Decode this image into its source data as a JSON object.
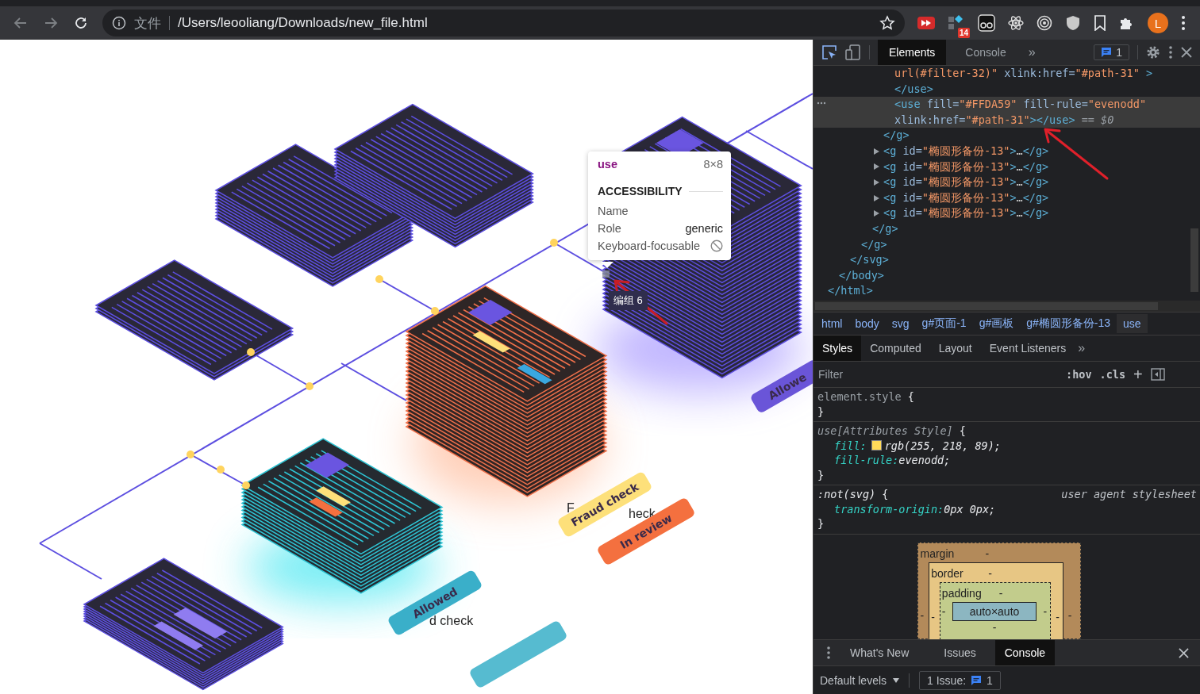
{
  "browser": {
    "site_label": "文件",
    "url": "/Users/leooliang/Downloads/new_file.html",
    "extension_badge": "14",
    "avatar_initial": "L"
  },
  "canvas": {
    "tooltip": {
      "tag": "use",
      "size": "8×8",
      "section": "ACCESSIBILITY",
      "rows": [
        {
          "label": "Name",
          "kind": "empty"
        },
        {
          "label": "Role",
          "kind": "text",
          "value": "generic"
        },
        {
          "label": "Keyboard-focusable",
          "kind": "not-focusable"
        }
      ]
    },
    "group_label": "编组 6",
    "captions": [
      "d check",
      "F",
      "heck"
    ],
    "tags": [
      {
        "text": "Allowed",
        "color": "#3aafc9"
      },
      {
        "text": "Allowe",
        "color": "#6a55d8"
      },
      {
        "text": "Fraud check",
        "color": "#fde07a"
      },
      {
        "text": "In review",
        "color": "#f4703f"
      }
    ]
  },
  "devtools": {
    "tabs": [
      {
        "label": "Elements",
        "selected": true
      },
      {
        "label": "Console",
        "selected": false
      }
    ],
    "more": "»",
    "issues_count": "1",
    "dom": [
      {
        "expanded": true,
        "close": [
          {
            "kind": "tag",
            "t": "</html>"
          }
        ],
        "children": [
          {
            "expanded": true,
            "close": [
              {
                "kind": "tag",
                "t": "</body>"
              }
            ],
            "children": [
              {
                "expanded": true,
                "close": [
                  {
                    "kind": "tag",
                    "t": "</svg>"
                  }
                ],
                "children": [
                  {
                    "expanded": true,
                    "close": [
                      {
                        "kind": "tag",
                        "t": "</g>"
                      }
                    ],
                    "children": [
                      {
                        "expanded": true,
                        "close": [
                          {
                            "kind": "tag",
                            "t": "</g>"
                          }
                        ],
                        "children": [
                          {
                            "expanded": true,
                            "close": [
                              {
                                "kind": "tag",
                                "t": "</g>"
                              }
                            ],
                            "children": [
                              {
                                "selected": false,
                                "lines": [
                                  [
                                    {
                                      "kind": "value",
                                      "t": "url(#filter-32)\""
                                    },
                                    {
                                      "kind": "attr",
                                      "t": "  xlink:href="
                                    },
                                    {
                                      "kind": "value",
                                      "t": "\"#path-31\""
                                    },
                                    {
                                      "kind": "tag",
                                      "t": " >"
                                    }
                                  ],
                                  [
                                    {
                                      "kind": "tag",
                                      "t": "</use>"
                                    }
                                  ]
                                ]
                              },
                              {
                                "selected": true,
                                "lines": [
                                  [
                                    {
                                      "kind": "tag",
                                      "t": "<use"
                                    },
                                    {
                                      "kind": "attr",
                                      "t": " fill="
                                    },
                                    {
                                      "kind": "value",
                                      "t": "\"#FFDA59\""
                                    },
                                    {
                                      "kind": "attr",
                                      "t": " fill-rule="
                                    },
                                    {
                                      "kind": "value",
                                      "t": "\"evenodd\""
                                    }
                                  ],
                                  [
                                    {
                                      "kind": "attr",
                                      "t": "xlink:href="
                                    },
                                    {
                                      "kind": "value",
                                      "t": "\"#path-31\""
                                    },
                                    {
                                      "kind": "tag",
                                      "t": "></use>"
                                    },
                                    {
                                      "kind": "comment",
                                      "t": " == $0"
                                    }
                                  ]
                                ]
                              }
                            ]
                          },
                          {
                            "expanded": false,
                            "tokens": [
                              {
                                "kind": "tag",
                                "t": "<g"
                              },
                              {
                                "kind": "attr",
                                "t": " id="
                              },
                              {
                                "kind": "value",
                                "t": "\"椭圆形备份-13\""
                              },
                              {
                                "kind": "tag",
                                "t": ">"
                              },
                              {
                                "kind": "text",
                                "t": "…"
                              },
                              {
                                "kind": "tag",
                                "t": "</g>"
                              }
                            ]
                          },
                          {
                            "expanded": false,
                            "tokens": [
                              {
                                "kind": "tag",
                                "t": "<g"
                              },
                              {
                                "kind": "attr",
                                "t": " id="
                              },
                              {
                                "kind": "value",
                                "t": "\"椭圆形备份-13\""
                              },
                              {
                                "kind": "tag",
                                "t": ">"
                              },
                              {
                                "kind": "text",
                                "t": "…"
                              },
                              {
                                "kind": "tag",
                                "t": "</g>"
                              }
                            ]
                          },
                          {
                            "expanded": false,
                            "tokens": [
                              {
                                "kind": "tag",
                                "t": "<g"
                              },
                              {
                                "kind": "attr",
                                "t": " id="
                              },
                              {
                                "kind": "value",
                                "t": "\"椭圆形备份-13\""
                              },
                              {
                                "kind": "tag",
                                "t": ">"
                              },
                              {
                                "kind": "text",
                                "t": "…"
                              },
                              {
                                "kind": "tag",
                                "t": "</g>"
                              }
                            ]
                          },
                          {
                            "expanded": false,
                            "tokens": [
                              {
                                "kind": "tag",
                                "t": "<g"
                              },
                              {
                                "kind": "attr",
                                "t": " id="
                              },
                              {
                                "kind": "value",
                                "t": "\"椭圆形备份-13\""
                              },
                              {
                                "kind": "tag",
                                "t": ">"
                              },
                              {
                                "kind": "text",
                                "t": "…"
                              },
                              {
                                "kind": "tag",
                                "t": "</g>"
                              }
                            ]
                          },
                          {
                            "expanded": false,
                            "tokens": [
                              {
                                "kind": "tag",
                                "t": "<g"
                              },
                              {
                                "kind": "attr",
                                "t": " id="
                              },
                              {
                                "kind": "value",
                                "t": "\"椭圆形备份-13\""
                              },
                              {
                                "kind": "tag",
                                "t": ">"
                              },
                              {
                                "kind": "text",
                                "t": "…"
                              },
                              {
                                "kind": "tag",
                                "t": "</g>"
                              }
                            ]
                          }
                        ]
                      }
                    ]
                  }
                ]
              }
            ]
          }
        ]
      }
    ],
    "breadcrumbs": [
      {
        "label": "html",
        "selected": false
      },
      {
        "label": "body",
        "selected": false
      },
      {
        "label": "svg",
        "selected": false
      },
      {
        "label": "g#页面-1",
        "selected": false
      },
      {
        "label": "g#画板",
        "selected": false
      },
      {
        "label": "g#椭圆形备份-13",
        "selected": false
      },
      {
        "label": "use",
        "selected": true
      }
    ],
    "pane_tabs": [
      {
        "label": "Styles",
        "selected": true
      },
      {
        "label": "Computed",
        "selected": false
      },
      {
        "label": "Layout",
        "selected": false
      },
      {
        "label": "Event Listeners",
        "selected": false
      }
    ],
    "pane_more": "»",
    "filter": {
      "placeholder": "Filter",
      "hov": ":hov",
      "cls": ".cls",
      "add": "+"
    },
    "rules": [
      {
        "kind": "inline",
        "selector": "element.style",
        "open": "{",
        "close": "}"
      },
      {
        "kind": "attributes",
        "selector": "use[Attributes Style]",
        "open": "{",
        "close": "}",
        "props": [
          {
            "name": "fill:",
            "value": "rgb(255, 218, 89);",
            "color": "#ffda59"
          },
          {
            "name": "fill-rule:",
            "value": "evenodd;"
          }
        ]
      },
      {
        "kind": "user-agent",
        "selector": ":not(svg)",
        "open": "{",
        "close": "}",
        "origin": "user agent stylesheet",
        "props": [
          {
            "name": "transform-origin:",
            "value": "0px 0px;"
          }
        ]
      }
    ],
    "box_model": {
      "margin": {
        "label": "margin",
        "top": "-",
        "left": "-",
        "right": "-"
      },
      "border": {
        "label": "border",
        "top": "-",
        "left": "-",
        "right": "-"
      },
      "padding": {
        "label": "padding",
        "top": "-",
        "left": "-",
        "right": "-",
        "bottom": "-"
      },
      "content": "auto×auto"
    },
    "drawer": {
      "tabs": [
        {
          "label": "What's New",
          "selected": false
        },
        {
          "label": "Issues",
          "selected": false
        },
        {
          "label": "Console",
          "selected": true
        }
      ],
      "levels": "Default levels",
      "issues_label": "1 Issue:",
      "issues_count": "1"
    }
  }
}
